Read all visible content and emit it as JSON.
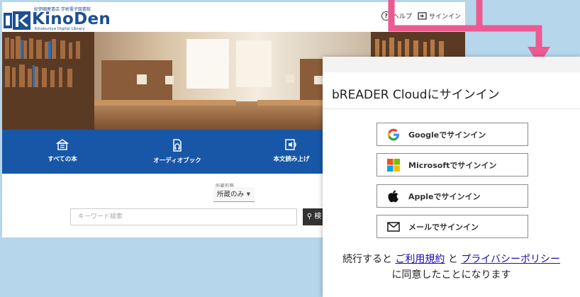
{
  "site": {
    "logo_small": "紀伊國屋書店 学術電子図書館",
    "logo_main": "KinoDen",
    "logo_sub": "Kinokuniya Digital Library",
    "help_label": "ヘルプ",
    "signin_label": "サインイン",
    "nav": [
      {
        "label": "すべての本",
        "icon": "library-icon"
      },
      {
        "label": "オーディオブック",
        "icon": "audiobook-icon"
      },
      {
        "label": "本文読み上げ",
        "icon": "text-to-speech-icon"
      }
    ],
    "filter_label": "所蔵形態",
    "filter_value": "所蔵のみ",
    "search_placeholder": "キーワード検索",
    "search_button_label": "検"
  },
  "panel": {
    "title": "bREADER Cloudにサインイン",
    "buttons": [
      {
        "label": "Googleでサインイン",
        "icon": "google-icon"
      },
      {
        "label": "Microsoftでサインイン",
        "icon": "microsoft-icon"
      },
      {
        "label": "Appleでサインイン",
        "icon": "apple-icon"
      },
      {
        "label": "メールでサインイン",
        "icon": "mail-icon"
      }
    ],
    "legal_prefix": "続行すると",
    "terms_link": "ご利用規約",
    "legal_and": "と",
    "privacy_link": "プライバシーポリシー",
    "legal_suffix": "に同意したことになります"
  },
  "colors": {
    "nav_band": "#1857a8",
    "arrow": "#ec5a92",
    "background": "#b6d6ec",
    "link": "#1a0dab"
  }
}
